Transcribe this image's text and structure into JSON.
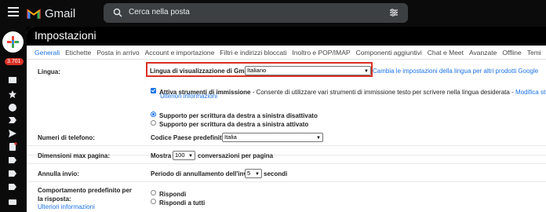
{
  "app": {
    "name": "Gmail",
    "unread_badge": "3.701"
  },
  "search": {
    "placeholder": "Cerca nella posta"
  },
  "page": {
    "title": "Impostazioni"
  },
  "tabs": [
    {
      "label": "Generali"
    },
    {
      "label": "Etichette"
    },
    {
      "label": "Posta in arrivo"
    },
    {
      "label": "Account e importazione"
    },
    {
      "label": "Filtri e indirizzi bloccati"
    },
    {
      "label": "Inoltro e POP/IMAP"
    },
    {
      "label": "Componenti aggiuntivi"
    },
    {
      "label": "Chat e Meet"
    },
    {
      "label": "Avanzate"
    },
    {
      "label": "Offline"
    },
    {
      "label": "Temi"
    }
  ],
  "settings": {
    "language": {
      "label": "Lingua:",
      "display_label": "Lingua di visualizzazione di Gmail:",
      "display_value": "Italiano",
      "change_link": "Cambia le impostazioni della lingua per altri prodotti Google",
      "input_tools_label": "Attiva strumenti di immissione",
      "input_tools_desc": " - Consente di utilizzare vari strumenti di immissione testo per scrivere nella lingua desiderata - ",
      "input_tools_link": "Modifica strumenti",
      "more_info": "Ulteriori informazioni",
      "rtl_off": "Supporto per scrittura da destra a sinistra disattivato",
      "rtl_on": "Supporto per scrittura da destra a sinistra attivato"
    },
    "phone": {
      "label": "Numeri di telefono:",
      "country_label": "Codice Paese predefinito:",
      "country_value": "Italia"
    },
    "page_size": {
      "label": "Dimensioni max pagina:",
      "prefix": "Mostra",
      "value": "100",
      "suffix": "conversazioni per pagina"
    },
    "undo_send": {
      "label": "Annulla invio:",
      "period_label": "Periodo di annullamento dell'invio:",
      "value": "5",
      "suffix": "secondi"
    },
    "reply": {
      "label": "Comportamento predefinito per la risposta:",
      "more_info": "Ulteriori informazioni",
      "opt_reply": "Rispondi",
      "opt_reply_all": "Rispondi a tutti"
    }
  },
  "colors": {
    "accent": "#1a73e8",
    "highlight": "#d93025"
  }
}
